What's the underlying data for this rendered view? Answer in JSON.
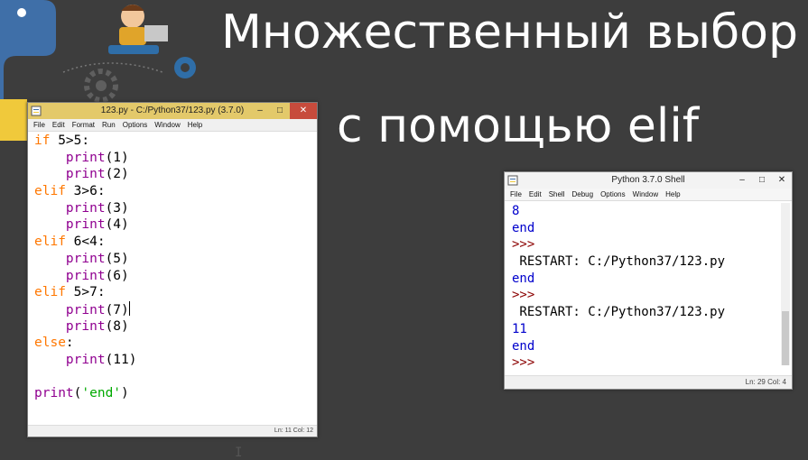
{
  "slide": {
    "title_line1": "Множественный выбор",
    "title_line2": "с помощью elif"
  },
  "editor": {
    "window_title": "123.py - C:/Python37/123.py (3.7.0)",
    "menu": [
      "File",
      "Edit",
      "Format",
      "Run",
      "Options",
      "Window",
      "Help"
    ],
    "code_lines": [
      "if 5>5:",
      "    print(1)",
      "    print(2)",
      "elif 3>6:",
      "    print(3)",
      "    print(4)",
      "elif 6<4:",
      "    print(5)",
      "    print(6)",
      "elif 5>7:",
      "    print(7)",
      "    print(8)",
      "else:",
      "    print(11)",
      "",
      "print('end')"
    ],
    "status": "Ln: 11  Col: 12"
  },
  "shell": {
    "window_title": "Python 3.7.0 Shell",
    "menu": [
      "File",
      "Edit",
      "Shell",
      "Debug",
      "Options",
      "Window",
      "Help"
    ],
    "lines": [
      {
        "type": "out",
        "text": "8"
      },
      {
        "type": "out",
        "text": "end"
      },
      {
        "type": "prompt",
        "text": ">>>"
      },
      {
        "type": "plain",
        "text": " RESTART: C:/Python37/123.py"
      },
      {
        "type": "out",
        "text": "end"
      },
      {
        "type": "prompt",
        "text": ">>>"
      },
      {
        "type": "plain",
        "text": " RESTART: C:/Python37/123.py"
      },
      {
        "type": "out",
        "text": "11"
      },
      {
        "type": "out",
        "text": "end"
      },
      {
        "type": "prompt",
        "text": ">>>"
      }
    ],
    "status": "Ln: 29  Col: 4"
  },
  "colors": {
    "background": "#3d3d3d",
    "keyword": "#ff7700",
    "builtin": "#900090",
    "string": "#00aa00",
    "output": "#0000cc",
    "prompt": "#8b0000"
  }
}
